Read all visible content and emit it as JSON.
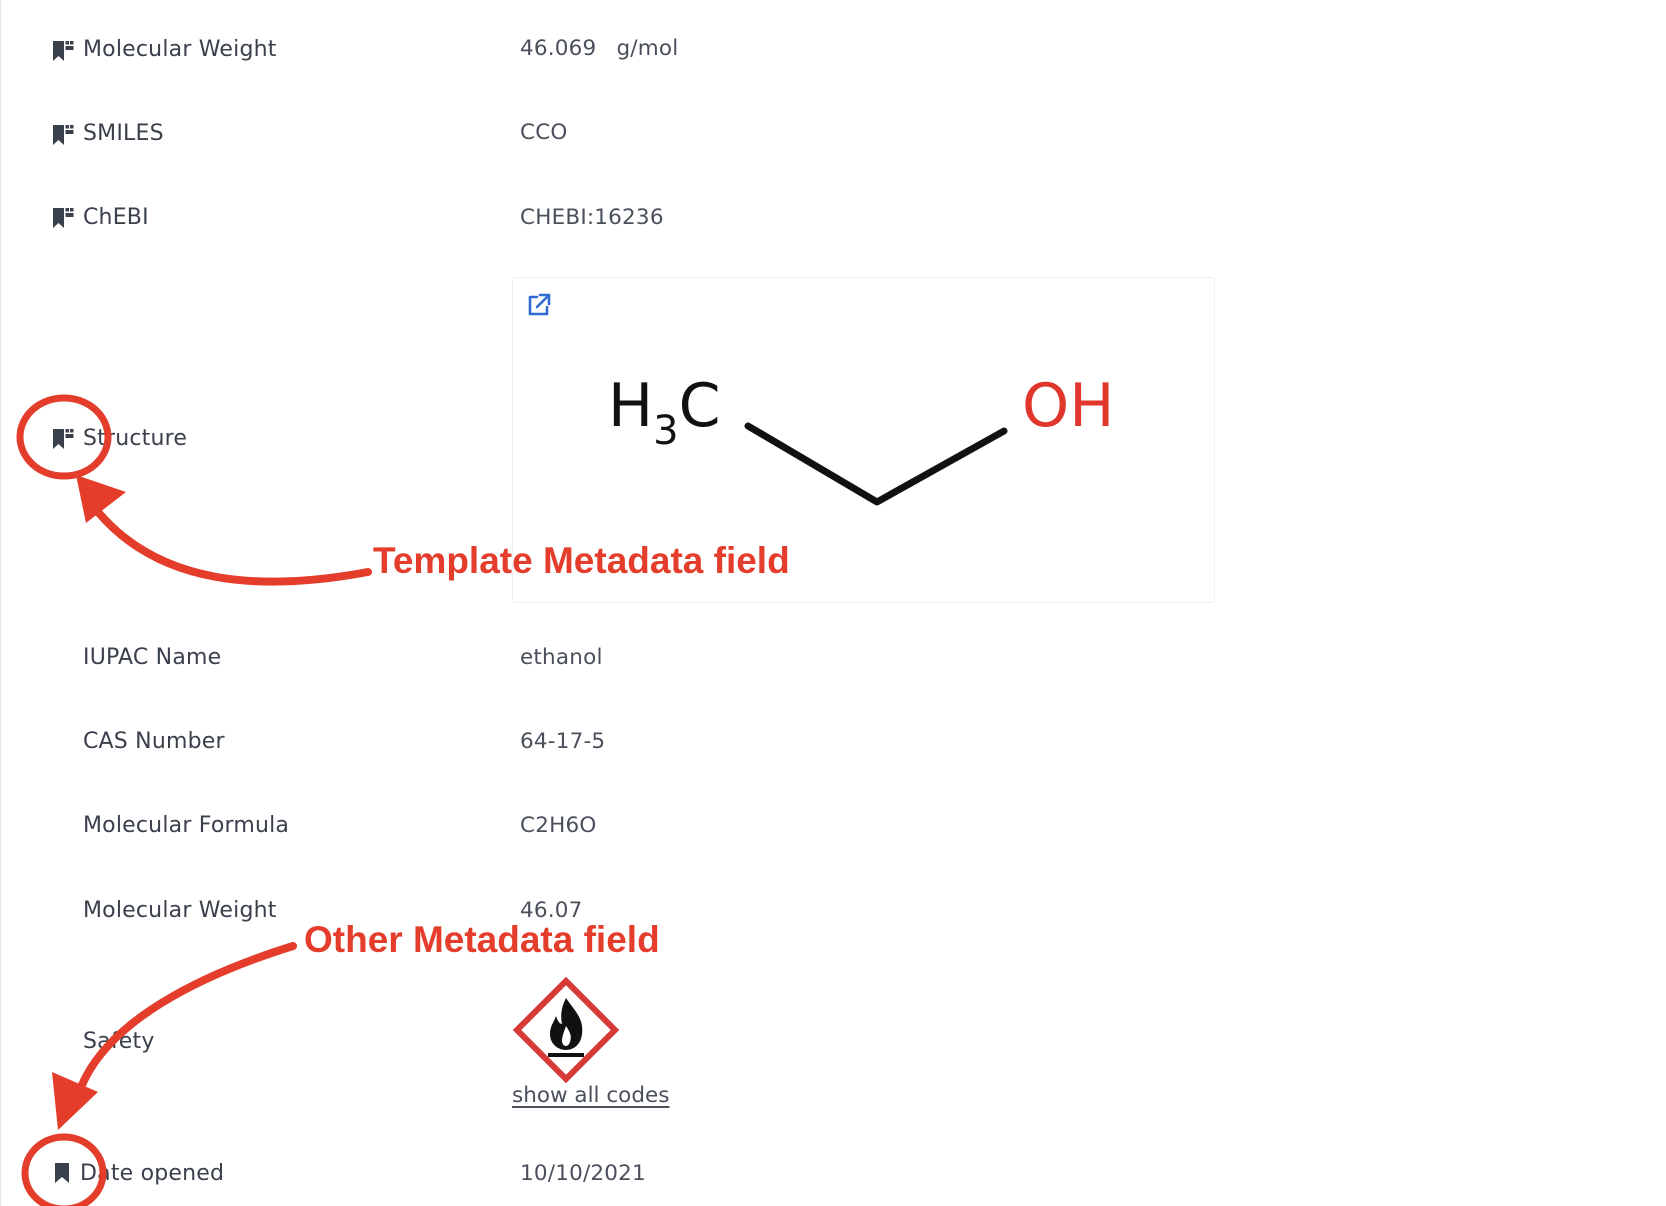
{
  "fields": [
    {
      "label": "Molecular Weight",
      "value": "46.069",
      "unit": "g/mol"
    },
    {
      "label": "SMILES",
      "value": "CCO"
    },
    {
      "label": "ChEBI",
      "value": "CHEBI:16236"
    },
    {
      "label": "Structure"
    },
    {
      "label": "IUPAC Name",
      "value": "ethanol"
    },
    {
      "label": "CAS Number",
      "value": "64-17-5"
    },
    {
      "label": "Molecular Formula",
      "value": "C2H6O"
    },
    {
      "label": "Molecular Weight",
      "value": "46.07"
    },
    {
      "label": "Safety",
      "link": "show all codes"
    },
    {
      "label": "Date opened",
      "value": "10/10/2021"
    }
  ],
  "structure": {
    "left_group_main": "H",
    "left_group_sub": "3",
    "left_group_end": "C",
    "right_group": "OH",
    "hetero_atom_color": "#e0362c"
  },
  "annotations": {
    "template_field": "Template Metadata field",
    "other_field": "Other Metadata field",
    "color": "#e43d2b"
  },
  "icons": {
    "template_field": "template-bookmark-icon",
    "other_field": "bookmark-icon",
    "structure_link": "external-link-icon",
    "hazard": "flammable-hazard-icon"
  }
}
